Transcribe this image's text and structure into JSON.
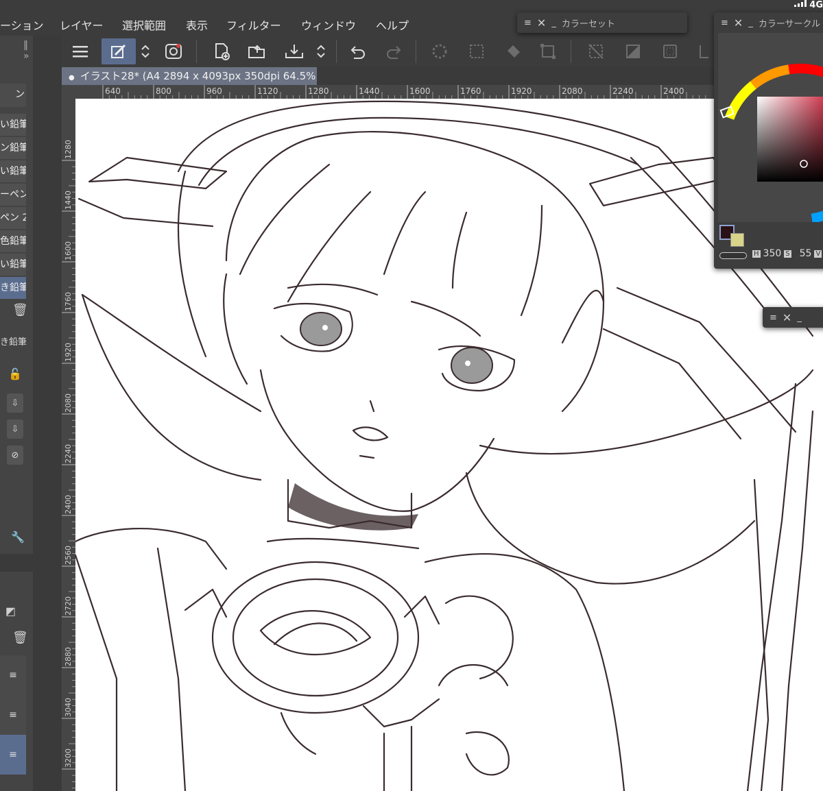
{
  "menu": {
    "items": [
      "ーション",
      "レイヤー",
      "選択範囲",
      "表示",
      "フィルター",
      "ウィンドウ",
      "ヘルプ"
    ]
  },
  "status": {
    "network": "4G"
  },
  "toolbar": {
    "icons": [
      "menu-icon",
      "brush-settings-icon",
      "updown-icon",
      "eraser-tool-icon",
      "new-file-icon",
      "open-folder-icon",
      "save-icon",
      "updown-icon",
      "undo-icon",
      "redo-icon",
      "loading-icon",
      "select-all-icon",
      "fill-icon",
      "transform-icon",
      "deselect-icon",
      "invert-selection-icon",
      "crop-icon"
    ]
  },
  "document": {
    "tab_label": "イラスト28* (A4 2894 x 4093px 350dpi 64.5%)"
  },
  "left_panel": {
    "brush_items": [
      "い鉛筆",
      "ン鉛筆",
      "い鉛筆",
      "ーペン",
      "ペン 2",
      "色鉛筆",
      "い鉛筆",
      "き鉛筆"
    ],
    "selected_brush_index": 7,
    "sub_label": "き鉛筆",
    "first_tab": "ン"
  },
  "rulers": {
    "horizontal": [
      "640",
      "800",
      "960",
      "1120",
      "1280",
      "1440",
      "1600",
      "1760",
      "1920",
      "2080",
      "2240",
      "2400"
    ],
    "vertical": [
      "1280",
      "1440",
      "1600",
      "1760",
      "1920",
      "2080",
      "2240",
      "2400",
      "2560",
      "2720",
      "2880",
      "3040",
      "3200"
    ]
  },
  "panels": {
    "color_set": {
      "title": "カラーセット"
    },
    "color_circle": {
      "title": "カラーサークル",
      "h_label": "H",
      "h_value": "350",
      "s_label": "S",
      "s_value": "55",
      "v_label": "V"
    }
  },
  "colors": {
    "main_color": "#2a1116",
    "sub_color": "#d8d48a",
    "accent": "#5b6d8f"
  }
}
